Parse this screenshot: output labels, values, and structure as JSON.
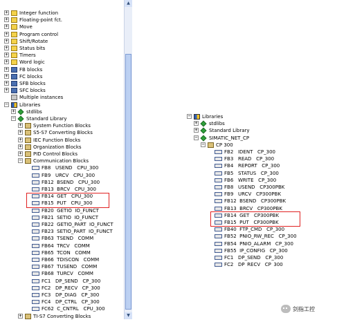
{
  "left_tree": {
    "items": [
      {
        "label": "Integer function",
        "depth": 0,
        "exp": "+",
        "icon": "lib"
      },
      {
        "label": "Floating-point fct.",
        "depth": 0,
        "exp": "+",
        "icon": "lib"
      },
      {
        "label": "Move",
        "depth": 0,
        "exp": "+",
        "icon": "lib"
      },
      {
        "label": "Program control",
        "depth": 0,
        "exp": "+",
        "icon": "lib"
      },
      {
        "label": "Shift/Rotate",
        "depth": 0,
        "exp": "+",
        "icon": "lib"
      },
      {
        "label": "Status bits",
        "depth": 0,
        "exp": "+",
        "icon": "lib"
      },
      {
        "label": "Timers",
        "depth": 0,
        "exp": "+",
        "icon": "lib"
      },
      {
        "label": "Word logic",
        "depth": 0,
        "exp": "+",
        "icon": "lib"
      },
      {
        "label": "FB blocks",
        "depth": 0,
        "exp": "+",
        "icon": "blk"
      },
      {
        "label": "FC blocks",
        "depth": 0,
        "exp": "+",
        "icon": "blk"
      },
      {
        "label": "SFB blocks",
        "depth": 0,
        "exp": "+",
        "icon": "blk"
      },
      {
        "label": "SFC blocks",
        "depth": 0,
        "exp": "+",
        "icon": "blk"
      },
      {
        "label": "Multiple instances",
        "depth": 0,
        "exp": "",
        "icon": "misc"
      },
      {
        "label": "Libraries",
        "depth": 0,
        "exp": "-",
        "icon": "book"
      },
      {
        "label": "stdlibs",
        "depth": 1,
        "exp": "+",
        "icon": "diamond"
      },
      {
        "label": "Standard Library",
        "depth": 1,
        "exp": "-",
        "icon": "diamond"
      },
      {
        "label": "System Function Blocks",
        "depth": 2,
        "exp": "+",
        "icon": "folder"
      },
      {
        "label": "S5-S7 Converting Blocks",
        "depth": 2,
        "exp": "+",
        "icon": "folder"
      },
      {
        "label": "IEC Function Blocks",
        "depth": 2,
        "exp": "+",
        "icon": "folder"
      },
      {
        "label": "Organization Blocks",
        "depth": 2,
        "exp": "+",
        "icon": "folder"
      },
      {
        "label": "PID Control Blocks",
        "depth": 2,
        "exp": "+",
        "icon": "folder"
      },
      {
        "label": "Communication Blocks",
        "depth": 2,
        "exp": "-",
        "icon": "folder"
      },
      {
        "label": "FB8   USEND   CPU_300",
        "depth": 3,
        "exp": "",
        "icon": "fb"
      },
      {
        "label": "FB9   URCV   CPU_300",
        "depth": 3,
        "exp": "",
        "icon": "fb"
      },
      {
        "label": "FB12  BSEND   CPU_300",
        "depth": 3,
        "exp": "",
        "icon": "fb"
      },
      {
        "label": "FB13  BRCV   CPU_300",
        "depth": 3,
        "exp": "",
        "icon": "fb"
      },
      {
        "label": "FB14  GET   CPU_300",
        "depth": 3,
        "exp": "",
        "icon": "fb"
      },
      {
        "label": "FB15  PUT   CPU_300",
        "depth": 3,
        "exp": "",
        "icon": "fb"
      },
      {
        "label": "FB20  GETIO  IO_FUNCT",
        "depth": 3,
        "exp": "",
        "icon": "fb"
      },
      {
        "label": "FB21  SETIO  IO_FUNCT",
        "depth": 3,
        "exp": "",
        "icon": "fb"
      },
      {
        "label": "FB22  GETIO_PART  IO_FUNCT",
        "depth": 3,
        "exp": "",
        "icon": "fb"
      },
      {
        "label": "FB23  SETIO_PART  IO_FUNCT",
        "depth": 3,
        "exp": "",
        "icon": "fb"
      },
      {
        "label": "FB63  TSEND   COMM",
        "depth": 3,
        "exp": "",
        "icon": "fb"
      },
      {
        "label": "FB64  TRCV   COMM",
        "depth": 3,
        "exp": "",
        "icon": "fb"
      },
      {
        "label": "FB65  TCON   COMM",
        "depth": 3,
        "exp": "",
        "icon": "fb"
      },
      {
        "label": "FB66  TDISCON   COMM",
        "depth": 3,
        "exp": "",
        "icon": "fb"
      },
      {
        "label": "FB67  TUSEND   COMM",
        "depth": 3,
        "exp": "",
        "icon": "fb"
      },
      {
        "label": "FB68  TURCV   COMM",
        "depth": 3,
        "exp": "",
        "icon": "fb"
      },
      {
        "label": "FC1   DP_SEND   CP_300",
        "depth": 3,
        "exp": "",
        "icon": "fb"
      },
      {
        "label": "FC2   DP_RECV   CP_300",
        "depth": 3,
        "exp": "",
        "icon": "fb"
      },
      {
        "label": "FC3   DP_DIAG   CP_300",
        "depth": 3,
        "exp": "",
        "icon": "fb"
      },
      {
        "label": "FC4   DP_CTRL   CP_300",
        "depth": 3,
        "exp": "",
        "icon": "fb"
      },
      {
        "label": "FC62  C_CNTRL   CPU_300",
        "depth": 3,
        "exp": "",
        "icon": "fb"
      },
      {
        "label": "TI-S7 Converting Blocks",
        "depth": 2,
        "exp": "+",
        "icon": "folder"
      }
    ]
  },
  "right_tree": {
    "items": [
      {
        "label": "Libraries",
        "depth": 0,
        "exp": "-",
        "icon": "book"
      },
      {
        "label": "stdlibs",
        "depth": 1,
        "exp": "+",
        "icon": "diamond"
      },
      {
        "label": "Standard Library",
        "depth": 1,
        "exp": "+",
        "icon": "diamond"
      },
      {
        "label": "SIMATIC_NET_CP",
        "depth": 1,
        "exp": "-",
        "icon": "diamond"
      },
      {
        "label": "CP 300",
        "depth": 2,
        "exp": "-",
        "icon": "folder"
      },
      {
        "label": "FB2   IDENT   CP_300",
        "depth": 3,
        "exp": "",
        "icon": "fb"
      },
      {
        "label": "FB3   READ   CP_300",
        "depth": 3,
        "exp": "",
        "icon": "fb"
      },
      {
        "label": "FB4   REPORT   CP_300",
        "depth": 3,
        "exp": "",
        "icon": "fb"
      },
      {
        "label": "FB5   STATUS   CP_300",
        "depth": 3,
        "exp": "",
        "icon": "fb"
      },
      {
        "label": "FB6   WRITE   CP_300",
        "depth": 3,
        "exp": "",
        "icon": "fb"
      },
      {
        "label": "FB8   USEND   CP300PBK",
        "depth": 3,
        "exp": "",
        "icon": "fb"
      },
      {
        "label": "FB9   URCV   CP300PBK",
        "depth": 3,
        "exp": "",
        "icon": "fb"
      },
      {
        "label": "FB12  BSEND   CP300PBK",
        "depth": 3,
        "exp": "",
        "icon": "fb"
      },
      {
        "label": "FB13  BRCV   CP300PBK",
        "depth": 3,
        "exp": "",
        "icon": "fb"
      },
      {
        "label": "FB14  GET   CP300PBK",
        "depth": 3,
        "exp": "",
        "icon": "fb"
      },
      {
        "label": "FB15  PUT   CP300PBK",
        "depth": 3,
        "exp": "",
        "icon": "fb"
      },
      {
        "label": "FB40  FTP_CMD   CP_300",
        "depth": 3,
        "exp": "",
        "icon": "fb"
      },
      {
        "label": "FB52  PNIO_RW_REC   CP_300",
        "depth": 3,
        "exp": "",
        "icon": "fb"
      },
      {
        "label": "FB54  PNIO_ALARM   CP_300",
        "depth": 3,
        "exp": "",
        "icon": "fb"
      },
      {
        "label": "FB55  IP_CONFIG   CP_300",
        "depth": 3,
        "exp": "",
        "icon": "fb"
      },
      {
        "label": "FC1   DP_SEND   CP_300",
        "depth": 3,
        "exp": "",
        "icon": "fb"
      },
      {
        "label": "FC2   DP_RECV   CP_300",
        "depth": 3,
        "exp": "",
        "icon": "fb"
      }
    ]
  },
  "watermark": {
    "text": "剑指工控",
    "icon": "wechat-icon"
  }
}
